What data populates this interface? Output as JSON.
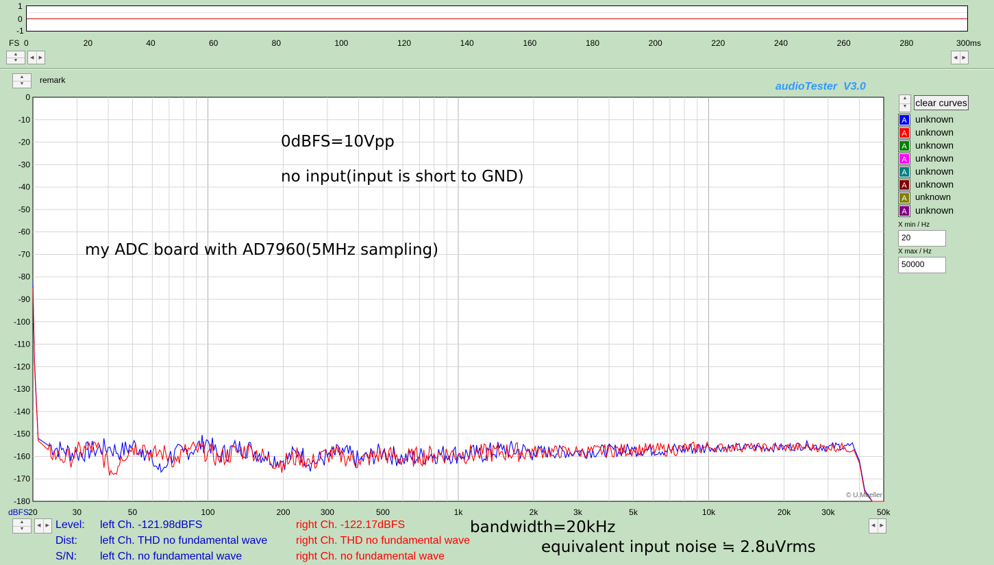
{
  "top_panel": {
    "y_ticks": [
      "1",
      "0",
      "-1"
    ],
    "y_unit": "FS",
    "x_ticks": [
      "0",
      "20",
      "40",
      "60",
      "80",
      "100",
      "120",
      "140",
      "160",
      "180",
      "200",
      "220",
      "240",
      "260",
      "280",
      "300ms"
    ]
  },
  "remark_label": "remark",
  "brand": "audioTester  V3.0",
  "copyright": "© U.Mueller",
  "clear_button": "clear curves",
  "legend": [
    {
      "label": "unknown",
      "color": "#0000ff",
      "glyph": "A"
    },
    {
      "label": "unknown",
      "color": "#ff0000",
      "glyph": "A"
    },
    {
      "label": "unknown",
      "color": "#008000",
      "glyph": "A"
    },
    {
      "label": "unknown",
      "color": "#ff00ff",
      "glyph": "A"
    },
    {
      "label": "unknown",
      "color": "#008080",
      "glyph": "A"
    },
    {
      "label": "unknown",
      "color": "#800000",
      "glyph": "A"
    },
    {
      "label": "unknown",
      "color": "#808000",
      "glyph": "A"
    },
    {
      "label": "unknown",
      "color": "#800080",
      "glyph": "A"
    }
  ],
  "xmin": {
    "label": "X min / Hz",
    "value": "20"
  },
  "xmax": {
    "label": "X max / Hz",
    "value": "50000"
  },
  "annotations": {
    "line1": "0dBFS=10Vpp",
    "line2": "no input(input is short to GND)",
    "line3": "my ADC board with AD7960(5MHz sampling)",
    "bandwidth": "bandwidth=20kHz",
    "noise": "equivalent input noise ≒ 2.8uVrms"
  },
  "status": {
    "level_label": "Level:",
    "dist_label": "Dist:",
    "sn_label": "S/N:",
    "level_left": "left Ch. -121.98dBFS",
    "level_right": "right Ch. -122.17dBFS",
    "dist_left": "left Ch. THD no fundamental wave",
    "dist_right": "right Ch. THD no fundamental wave",
    "sn_left": "left Ch.  no fundamental wave",
    "sn_right": "right Ch.  no fundamental wave"
  },
  "chart_data": {
    "type": "line",
    "xscale": "log",
    "xlim": [
      20,
      50000
    ],
    "ylim": [
      -180,
      0
    ],
    "grid": true,
    "ylabel": "dBFS",
    "y_ticks": [
      "0",
      "-10",
      "-20",
      "-30",
      "-40",
      "-50",
      "-60",
      "-70",
      "-80",
      "-90",
      "-100",
      "-110",
      "-120",
      "-130",
      "-140",
      "-150",
      "-160",
      "-170",
      "-180"
    ],
    "x_ticks": [
      {
        "v": 20,
        "label": "20"
      },
      {
        "v": 30,
        "label": "30"
      },
      {
        "v": 50,
        "label": "50"
      },
      {
        "v": 100,
        "label": "100"
      },
      {
        "v": 200,
        "label": "200"
      },
      {
        "v": 300,
        "label": "300"
      },
      {
        "v": 500,
        "label": "500"
      },
      {
        "v": 1000,
        "label": "1k"
      },
      {
        "v": 2000,
        "label": "2k"
      },
      {
        "v": 3000,
        "label": "3k"
      },
      {
        "v": 5000,
        "label": "5k"
      },
      {
        "v": 10000,
        "label": "10k"
      },
      {
        "v": 20000,
        "label": "20k"
      },
      {
        "v": 30000,
        "label": "30k"
      },
      {
        "v": 50000,
        "label": "50kHz"
      }
    ],
    "series": [
      {
        "color": "#0000ff",
        "x": [
          20,
          20.3,
          21,
          23,
          26,
          30,
          35,
          40,
          45,
          50,
          55,
          60,
          65,
          70,
          80,
          90,
          100,
          110,
          130,
          150,
          170,
          200,
          230,
          260,
          300,
          350,
          400,
          500,
          600,
          700,
          800,
          1000,
          1200,
          1500,
          2000,
          3000,
          5000,
          7000,
          10000,
          15000,
          20000,
          25000,
          30000,
          35000,
          38000,
          40000,
          42000,
          45000,
          50000
        ],
        "y": [
          -82,
          -118,
          -152,
          -155,
          -157,
          -159,
          -157,
          -156,
          -158,
          -155,
          -157,
          -162,
          -167,
          -160,
          -158,
          -156,
          -153,
          -160,
          -156,
          -157,
          -160,
          -162,
          -158,
          -163,
          -160,
          -158,
          -162,
          -158,
          -161,
          -160,
          -159,
          -159,
          -159,
          -157,
          -158,
          -158,
          -157,
          -157,
          -156,
          -156,
          -156,
          -155,
          -156,
          -155,
          -156,
          -162,
          -175,
          -180,
          -180
        ]
      },
      {
        "color": "#ff0000",
        "x": [
          20,
          20.3,
          21,
          23,
          25,
          28,
          30,
          33,
          36,
          40,
          42,
          45,
          50,
          55,
          60,
          65,
          70,
          75,
          80,
          90,
          100,
          110,
          130,
          150,
          170,
          200,
          230,
          260,
          300,
          350,
          400,
          500,
          600,
          700,
          800,
          1000,
          1200,
          1500,
          2000,
          3000,
          5000,
          7000,
          10000,
          15000,
          20000,
          25000,
          30000,
          35000,
          38000,
          40000,
          42000,
          45000,
          50000
        ],
        "y": [
          -85,
          -120,
          -153,
          -157,
          -160,
          -161,
          -158,
          -157,
          -156,
          -164,
          -168,
          -160,
          -156,
          -155,
          -160,
          -158,
          -160,
          -162,
          -158,
          -157,
          -158,
          -161,
          -158,
          -157,
          -161,
          -163,
          -160,
          -163,
          -159,
          -160,
          -162,
          -159,
          -161,
          -160,
          -159,
          -159,
          -159,
          -158,
          -158,
          -158,
          -157,
          -157,
          -156,
          -156,
          -156,
          -156,
          -156,
          -156,
          -157,
          -163,
          -176,
          -180,
          -180
        ]
      }
    ]
  }
}
